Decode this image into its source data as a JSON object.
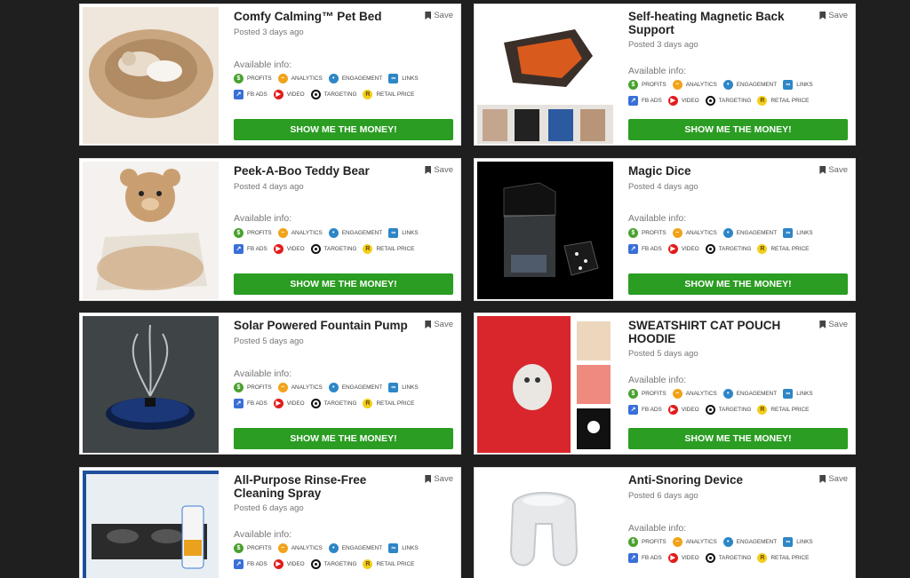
{
  "ui": {
    "save_label": "Save",
    "available_label": "Available info:",
    "cta_label": "SHOW ME THE MONEY!",
    "tags": [
      "PROFITS",
      "ANALYTICS",
      "ENGAGEMENT",
      "LINKS",
      "FB ADS",
      "VIDEO",
      "TARGETING",
      "RETAIL PRICE"
    ],
    "tag_icons": [
      "dollar-icon",
      "chart-icon",
      "people-icon",
      "link-icon",
      "fb-ads-icon",
      "video-icon",
      "target-icon",
      "retail-price-icon"
    ],
    "colors": {
      "page_bg": "#1f1f1f",
      "cta_green": "#2a9d22",
      "card_bg": "#ffffff"
    }
  },
  "products": [
    {
      "title": "Comfy Calming™ Pet Bed",
      "posted": "Posted 3 days ago",
      "image": "pet-bed-image"
    },
    {
      "title": "Self-heating Magnetic Back Support",
      "posted": "Posted 3 days ago",
      "image": "back-support-image"
    },
    {
      "title": "Peek-A-Boo Teddy Bear",
      "posted": "Posted 4 days ago",
      "image": "teddy-bear-image"
    },
    {
      "title": "Magic Dice",
      "posted": "Posted 4 days ago",
      "image": "magic-dice-image"
    },
    {
      "title": "Solar Powered Fountain Pump",
      "posted": "Posted 5 days ago",
      "image": "fountain-pump-image"
    },
    {
      "title": "SWEATSHIRT CAT POUCH HOODIE",
      "posted": "Posted 5 days ago",
      "image": "cat-hoodie-image"
    },
    {
      "title": "All-Purpose Rinse-Free Cleaning Spray",
      "posted": "Posted 6 days ago",
      "image": "cleaning-spray-image"
    },
    {
      "title": "Anti-Snoring Device",
      "posted": "Posted 6 days ago",
      "image": "anti-snoring-image"
    }
  ]
}
